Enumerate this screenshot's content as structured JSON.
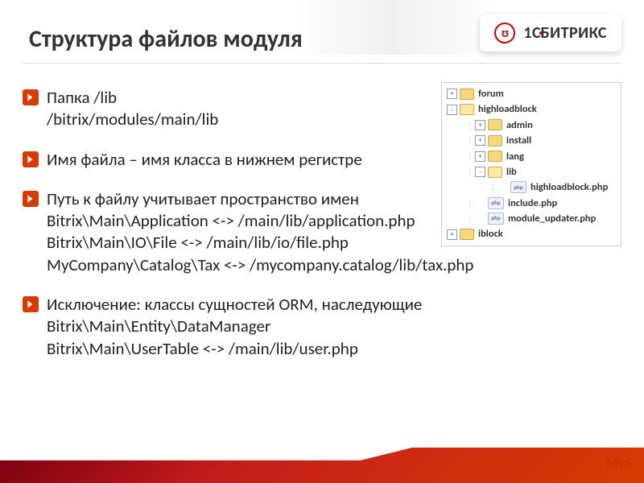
{
  "title": "Структура файлов модуля",
  "brand": {
    "left": "1С",
    "right": "БИТРИКС"
  },
  "bullets": [
    {
      "lines": [
        "Папка   /lib",
        "/bitrix/modules/main/lib"
      ]
    },
    {
      "lines": [
        "Имя файла – имя класса в нижнем регистре"
      ]
    },
    {
      "lines": [
        "Путь к файлу учитывает пространство имен",
        "Bitrix\\Main\\Application  <->  /main/lib/application.php",
        "Bitrix\\Main\\IO\\File  <->  /main/lib/io/file.php",
        "MyCompany\\Catalog\\Tax  <->  /mycompany.catalog/lib/tax.php"
      ]
    },
    {
      "lines": [
        "Исключение: классы сущностей ORM, наследующие",
        "Bitrix\\Main\\Entity\\DataManager",
        "Bitrix\\Main\\UserTable  <->  /main/lib/user.php"
      ]
    }
  ],
  "tree": [
    {
      "depth": 1,
      "twist": "+",
      "icon": "folder",
      "label": "forum"
    },
    {
      "depth": 1,
      "twist": "-",
      "icon": "folder-open",
      "label": "highloadblock"
    },
    {
      "depth": 2,
      "twist": "+",
      "icon": "folder",
      "label": "admin"
    },
    {
      "depth": 2,
      "twist": "+",
      "icon": "folder",
      "label": "install"
    },
    {
      "depth": 2,
      "twist": "+",
      "icon": "folder",
      "label": "lang"
    },
    {
      "depth": 2,
      "twist": "-",
      "icon": "folder-open",
      "label": "lib"
    },
    {
      "depth": 3,
      "twist": "",
      "icon": "php",
      "label": "highloadblock.php"
    },
    {
      "depth": 2,
      "twist": "",
      "icon": "php",
      "label": "include.php"
    },
    {
      "depth": 2,
      "twist": "",
      "icon": "php",
      "label": "module_updater.php"
    },
    {
      "depth": 1,
      "twist": "+",
      "icon": "folder",
      "label": "iblock"
    }
  ],
  "watermark": "MyS"
}
